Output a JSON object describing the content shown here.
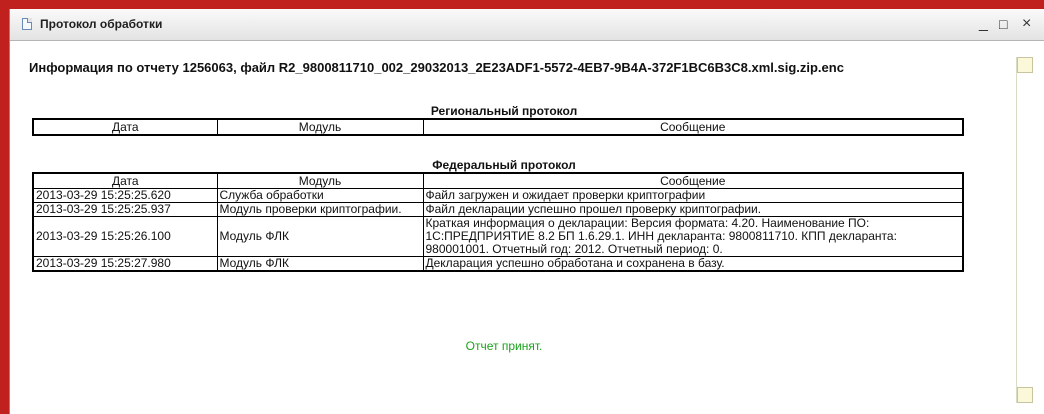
{
  "window": {
    "title": "Протокол обработки",
    "controls": {
      "minimize": "_",
      "maximize": "□",
      "close": "×"
    }
  },
  "header": {
    "info": "Информация по отчету 1256063, файл R2_9800811710_002_29032013_2E23ADF1-5572-4EB7-9B4A-372F1BC6B3C8.xml.sig.zip.enc"
  },
  "regional": {
    "title": "Региональный протокол",
    "columns": [
      "Дата",
      "Модуль",
      "Сообщение"
    ]
  },
  "federal": {
    "title": "Федеральный протокол",
    "columns": [
      "Дата",
      "Модуль",
      "Сообщение"
    ],
    "rows": [
      {
        "date": "2013-03-29 15:25:25.620",
        "module": "Служба обработки",
        "message": "Файл загружен и ожидает проверки криптографии"
      },
      {
        "date": "2013-03-29 15:25:25.937",
        "module": "Модуль проверки криптографии.",
        "message": "Файл декларации успешно прошел проверку криптографии."
      },
      {
        "date": "2013-03-29 15:25:26.100",
        "module": "Модуль ФЛК",
        "message": "Краткая информация о декларации: Версия формата: 4.20. Наименование ПО: 1С:ПРЕДПРИЯТИЕ 8.2 БП 1.6.29.1. ИНН декларанта: 9800811710. КПП декларанта: 980001001. Отчетный год: 2012. Отчетный период: 0."
      },
      {
        "date": "2013-03-29 15:25:27.980",
        "module": "Модуль ФЛК",
        "message": "Декларация успешно обработана и сохранена в базу."
      }
    ]
  },
  "status": {
    "text": "Отчет принят."
  },
  "colors": {
    "frame": "#c0201e",
    "status": "#1aa31a",
    "scroll": "#fbf7d9"
  }
}
